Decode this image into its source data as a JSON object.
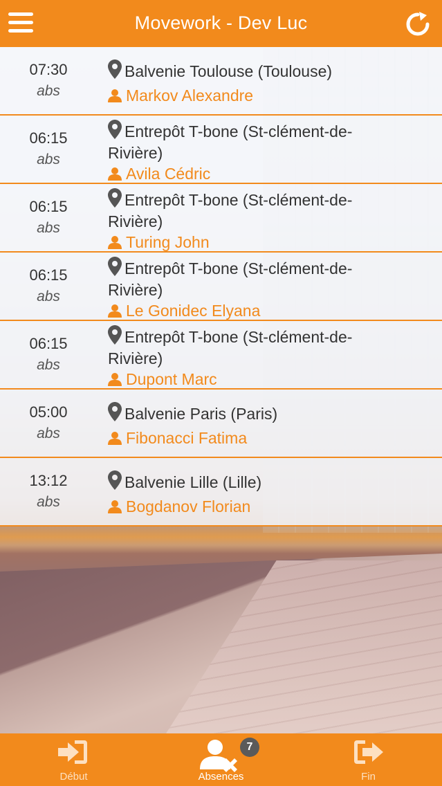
{
  "header": {
    "title": "Movework - Dev Luc",
    "menu_icon": "hamburger-menu-icon",
    "refresh_icon": "refresh-icon",
    "accent_color": "#f28a1c"
  },
  "entries": [
    {
      "time": "07:30",
      "status": "abs",
      "place_line1": "Balvenie Toulouse (Toulouse)",
      "place_line2": "",
      "person": "Markov Alexandre"
    },
    {
      "time": "06:15",
      "status": "abs",
      "place_line1": "Entrepôt T-bone (St-clément-de-",
      "place_line2": "Rivière)",
      "person": "Avila Cédric"
    },
    {
      "time": "06:15",
      "status": "abs",
      "place_line1": "Entrepôt T-bone (St-clément-de-",
      "place_line2": "Rivière)",
      "person": "Turing John"
    },
    {
      "time": "06:15",
      "status": "abs",
      "place_line1": "Entrepôt T-bone (St-clément-de-",
      "place_line2": "Rivière)",
      "person": "Le Gonidec Elyana"
    },
    {
      "time": "06:15",
      "status": "abs",
      "place_line1": "Entrepôt T-bone (St-clément-de-",
      "place_line2": "Rivière)",
      "person": "Dupont Marc"
    },
    {
      "time": "05:00",
      "status": "abs",
      "place_line1": "Balvenie Paris (Paris)",
      "place_line2": "",
      "person": "Fibonacci Fatima"
    },
    {
      "time": "13:12",
      "status": "abs",
      "place_line1": "Balvenie Lille (Lille)",
      "place_line2": "",
      "person": "Bogdanov Florian"
    }
  ],
  "tabbar": {
    "tabs": [
      {
        "label": "Début",
        "icon": "sign-in-icon",
        "active": false
      },
      {
        "label": "Absences",
        "icon": "user-remove-icon",
        "active": true
      },
      {
        "label": "Fin",
        "icon": "sign-out-icon",
        "active": false
      }
    ],
    "absences_badge": "7"
  }
}
